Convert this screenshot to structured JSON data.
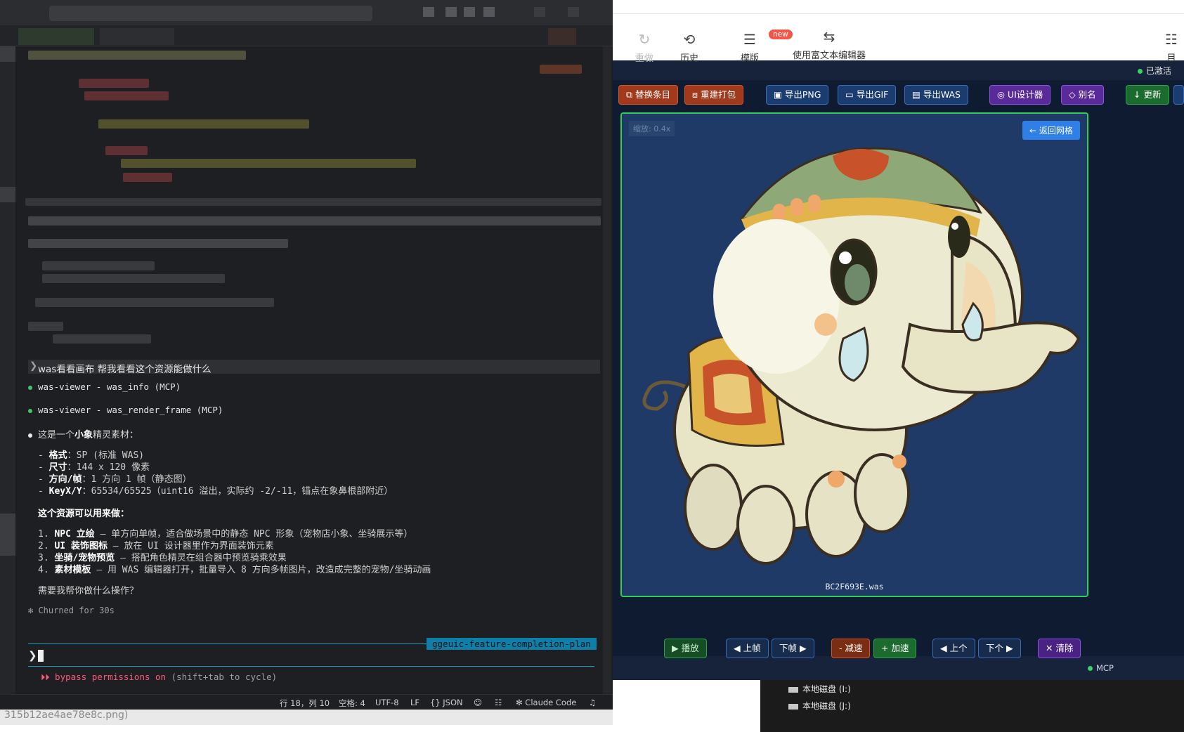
{
  "editor": {
    "prompt": "was看看画布 帮我看看这个资源能做什么",
    "tool_calls": [
      "was-viewer - was_info (MCP)",
      "was-viewer - was_render_frame (MCP)"
    ],
    "intro_prefix": "这是一个",
    "intro_bold": "小象",
    "intro_suffix": "精灵素材：",
    "info": [
      {
        "key": "格式",
        "value": "：SP (标准 WAS)"
      },
      {
        "key": "尺寸",
        "value": "：144 x 120 像素"
      },
      {
        "key": "方向/帧",
        "value": "：1 方向 1 帧（静态图）"
      },
      {
        "key": "KeyX/Y",
        "value": "：65534/65525（uint16 溢出，实际约 -2/-11，锚点在象鼻根部附近）"
      }
    ],
    "uses_title": "这个资源可以用来做：",
    "uses": [
      {
        "num": "1.",
        "key": "NPC 立绘",
        "value": " — 单方向单帧，适合做场景中的静态 NPC 形象（宠物店小象、坐骑展示等）"
      },
      {
        "num": "2.",
        "key": "UI 装饰图标",
        "value": " — 放在 UI 设计器里作为界面装饰元素"
      },
      {
        "num": "3.",
        "key": "坐骑/宠物预览",
        "value": " — 搭配角色精灵在组合器中预览骑乘效果"
      },
      {
        "num": "4.",
        "key": "素材模板",
        "value": " — 用 WAS 编辑器打开，批量导入 8 方向多帧图片，改造成完整的宠物/坐骑动画"
      }
    ],
    "question": "需要我帮你做什么操作？",
    "churned": "✻ Churned for 30s",
    "branch": "ggeuic-feature-completion-plan",
    "bypass_label": "bypass permissions on",
    "bypass_hint": "(shift+tab to cycle)",
    "status": {
      "position": "行 18，列 10",
      "spaces": "空格: 4",
      "encoding": "UTF-8",
      "eol": "LF",
      "language": "{} JSON",
      "claude": "✻ Claude Code"
    },
    "footer_filename": "315b12ae4ae78e8c.png)"
  },
  "viewer": {
    "toolbar": {
      "redo": "重做",
      "history": "历史",
      "template": "模版",
      "new_badge": "new",
      "rich_editor": "使用富文本编辑器",
      "list": "目"
    },
    "activated": "已激活",
    "actions": {
      "replace": "替换条目",
      "rebuild": "重建打包",
      "export_png": "导出PNG",
      "export_gif": "导出GIF",
      "export_was": "导出WAS",
      "ui_designer": "UI设计器",
      "alias": "别名",
      "update": "更新"
    },
    "canvas": {
      "zoom": "缩放: 0.4x",
      "back_to_grid": "← 返回网格",
      "filename": "BC2F693E.was"
    },
    "playback": {
      "play": "▶ 播放",
      "prev_frame": "◀ 上帧",
      "next_frame": "下帧 ▶",
      "slower": "- 减速",
      "faster": "+ 加速",
      "prev_item": "◀ 上个",
      "next_item": "下个 ▶",
      "clear": "✕ 清除"
    },
    "mcp": "MCP",
    "drives": [
      "本地磁盘 (I:)",
      "本地磁盘 (J:)"
    ]
  }
}
